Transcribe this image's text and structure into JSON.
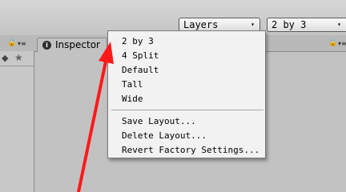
{
  "toolbar": {
    "layers_dropdown": {
      "label": "Layers",
      "arrow": "▾"
    },
    "layout_dropdown": {
      "label": "2 by 3",
      "arrow": "▾"
    }
  },
  "inspector_tab": {
    "label": "Inspector",
    "icon": "info-icon"
  },
  "layout_menu": {
    "layouts": [
      "2 by 3",
      "4 Split",
      "Default",
      "Tall",
      "Wide"
    ],
    "actions": [
      "Save Layout...",
      "Delete Layout...",
      "Revert Factory Settings..."
    ]
  },
  "colors": {
    "annotation_arrow": "#ff1a1a",
    "menu_bg": "#f2f2f2",
    "editor_bg": "#c2c2c2"
  }
}
